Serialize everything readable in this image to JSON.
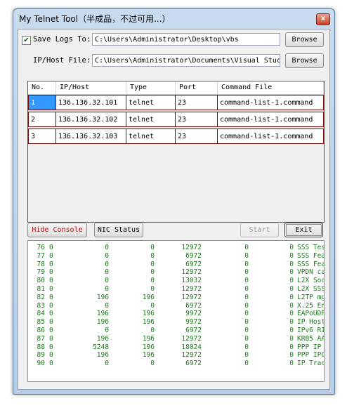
{
  "window": {
    "title": "My Telnet Tool（半成品，不过可用...）",
    "close_glyph": "x"
  },
  "settings": {
    "save_logs_checked": true,
    "save_logs_label": "Save Logs To:",
    "save_logs_path": "C:\\Users\\Administrator\\Desktop\\vbs",
    "iphost_label": "IP/Host File:",
    "iphost_path": "C:\\Users\\Administrator\\Documents\\Visual Stuc",
    "browse_label": "Browse"
  },
  "table": {
    "columns": [
      "No.",
      "IP/Host",
      "Type",
      "Port",
      "Command File"
    ],
    "rows": [
      [
        "1",
        "136.136.32.101",
        "telnet",
        "23",
        "command-list-1.command"
      ],
      [
        "2",
        "136.136.32.102",
        "telnet",
        "23",
        "command-list-1.command"
      ],
      [
        "3",
        "136.136.32.103",
        "telnet",
        "23",
        "command-list-1.command"
      ]
    ]
  },
  "buttons": {
    "hide_console": "Hide Console",
    "nic_status": "NIC Status",
    "start": "Start",
    "exit": "Exit"
  },
  "console": {
    "lines": [
      [
        "76",
        "0",
        "0",
        "0",
        "12972",
        "0",
        "0",
        "SSS Tes"
      ],
      [
        "77",
        "0",
        "0",
        "0",
        "6972",
        "0",
        "0",
        "SSS Fea"
      ],
      [
        "78",
        "0",
        "0",
        "0",
        "6972",
        "0",
        "0",
        "SSS Fea"
      ],
      [
        "79",
        "0",
        "0",
        "0",
        "12972",
        "0",
        "0",
        "VPDN ca"
      ],
      [
        "80",
        "0",
        "0",
        "0",
        "13032",
        "0",
        "0",
        "L2X Soc"
      ],
      [
        "81",
        "0",
        "0",
        "0",
        "12972",
        "0",
        "0",
        "L2X SSS"
      ],
      [
        "82",
        "0",
        "196",
        "196",
        "12972",
        "0",
        "0",
        "L2TP mg"
      ],
      [
        "83",
        "0",
        "0",
        "0",
        "6972",
        "0",
        "0",
        "X.25 En"
      ],
      [
        "84",
        "0",
        "196",
        "196",
        "9972",
        "0",
        "0",
        "EAPoUDP"
      ],
      [
        "85",
        "0",
        "196",
        "196",
        "9972",
        "0",
        "0",
        "IP Host"
      ],
      [
        "86",
        "0",
        "0",
        "0",
        "6972",
        "0",
        "0",
        "IPv6 RI"
      ],
      [
        "87",
        "0",
        "196",
        "196",
        "12972",
        "0",
        "0",
        "KRB5 AA"
      ],
      [
        "88",
        "0",
        "5248",
        "196",
        "18024",
        "0",
        "0",
        "PPP IP"
      ],
      [
        "89",
        "0",
        "196",
        "196",
        "12972",
        "0",
        "0",
        "PPP IPC"
      ],
      [
        "90",
        "0",
        "0",
        "0",
        "6972",
        "0",
        "0",
        "IP Trac"
      ]
    ]
  }
}
